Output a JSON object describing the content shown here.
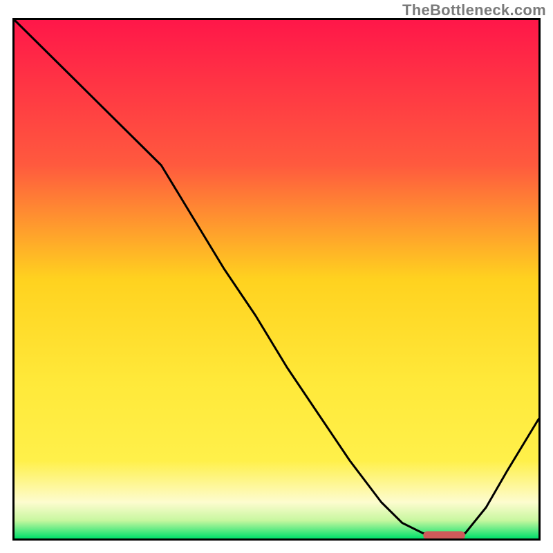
{
  "watermark": "TheBottleneck.com",
  "colors": {
    "gradient_top": "#ff1749",
    "gradient_mid1": "#ff7a3a",
    "gradient_mid2": "#ffd21f",
    "gradient_mid3": "#fff04a",
    "gradient_mid4": "#fdfccf",
    "gradient_bottom": "#00e06a",
    "border": "#000000",
    "curve": "#000000",
    "marker": "#cf5a5a"
  },
  "chart_data": {
    "type": "line",
    "title": "",
    "xlabel": "",
    "ylabel": "",
    "xlim": [
      0,
      100
    ],
    "ylim": [
      0,
      100
    ],
    "grid": false,
    "legend": false,
    "notes": "Background vertical gradient maps 0→green (bottom) to 100→red (top); curve shows bottleneck-score vs x. Values estimated from pixel positions.",
    "x": [
      0,
      6,
      12,
      18,
      24,
      28,
      34,
      40,
      46,
      52,
      58,
      64,
      70,
      74,
      78,
      82,
      86,
      90,
      94,
      100
    ],
    "values": [
      100,
      94,
      88,
      82,
      76,
      72,
      62,
      52,
      43,
      33,
      24,
      15,
      7,
      3,
      1,
      1,
      1,
      6,
      13,
      23
    ],
    "optimal_range": {
      "x_start": 78,
      "x_end": 86,
      "y": 0.6
    }
  }
}
